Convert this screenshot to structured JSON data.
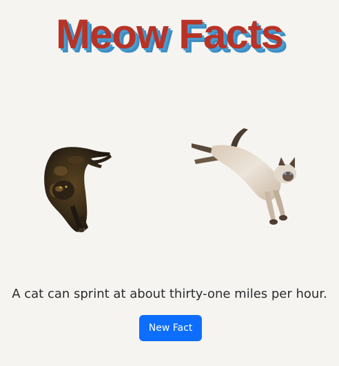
{
  "page": {
    "title": "Meow Facts"
  },
  "cats": {
    "left_icon": "tortoiseshell-cat-image",
    "right_icon": "siamese-cat-image"
  },
  "fact": {
    "text": "A cat can sprint at about thirty-one miles per hour."
  },
  "controls": {
    "new_fact_label": "New Fact"
  },
  "colors": {
    "background": "#f5f4f0",
    "title": "#b83327",
    "title_shadow": "#4a9ccf",
    "button": "#0d6efd",
    "text": "#2a2b2e"
  }
}
